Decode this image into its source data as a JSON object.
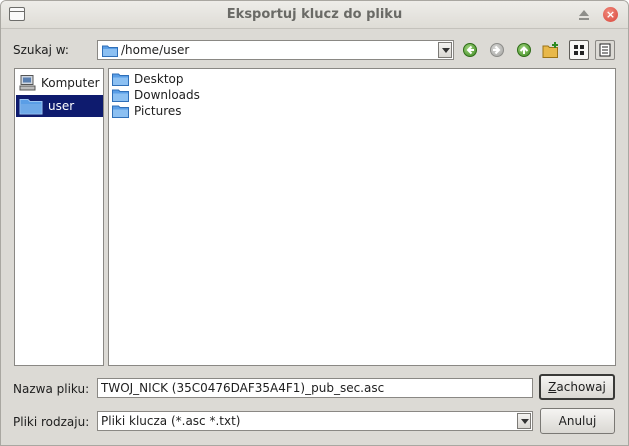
{
  "window": {
    "title": "Eksportuj klucz do pliku"
  },
  "lookin": {
    "label": "Szukaj w:",
    "path": "/home/user"
  },
  "places": [
    {
      "label": "Komputer",
      "icon": "computer-icon"
    },
    {
      "label": "user",
      "icon": "folder-icon"
    }
  ],
  "files": [
    {
      "label": "Desktop",
      "icon": "folder-icon"
    },
    {
      "label": "Downloads",
      "icon": "folder-icon"
    },
    {
      "label": "Pictures",
      "icon": "folder-icon"
    }
  ],
  "filename": {
    "label": "Nazwa pliku:",
    "value": "TWOJ_NICK (35C0476DAF35A4F1)_pub_sec.asc"
  },
  "filetype": {
    "label": "Pliki rodzaju:",
    "value": "Pliki klucza (*.asc *.txt)"
  },
  "buttons": {
    "save_mnemonic": "Z",
    "save_rest": "achowaj",
    "cancel": "Anuluj"
  },
  "colors": {
    "selection": "#0e1b6e",
    "folder": "#5a9ee6",
    "nav_green": "#3f8a22"
  }
}
